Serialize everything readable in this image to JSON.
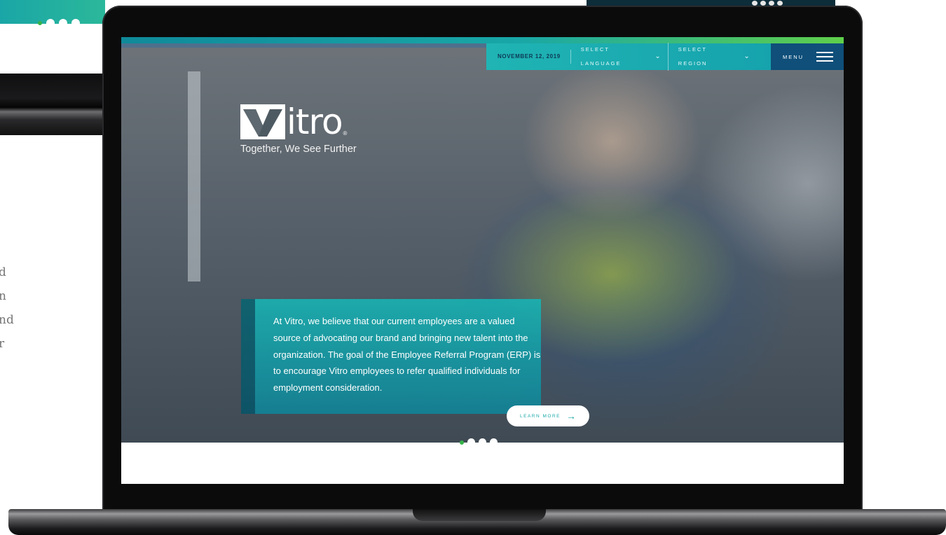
{
  "nav": {
    "date": "NOVEMBER 12, 2019",
    "language_label": "SELECT LANGUAGE",
    "region_label": "SELECT REGION",
    "menu_label": "MENU"
  },
  "logo": {
    "word": "itro",
    "registered": "®",
    "tagline": "Together, We See Further"
  },
  "hero": {
    "body": "At Vitro, we believe that our current employees are a valued source of advocating our brand and bringing new talent into the organization. The goal of the Employee Referral Program (ERP) is to encourage Vitro employees to refer qualified individuals for employment consideration.",
    "cta_label": "LEARN MORE",
    "cta_arrow": "→",
    "slides": 4,
    "active_slide": 1
  },
  "background": {
    "text_fragments": [
      "d",
      "n",
      "nd",
      "r"
    ]
  },
  "colors": {
    "teal": "#1aa8a8",
    "navy": "#0f4f7a",
    "green": "#36b34a"
  },
  "icons": [
    "chevron-down-icon",
    "hamburger-menu-icon",
    "arrow-right-icon"
  ]
}
